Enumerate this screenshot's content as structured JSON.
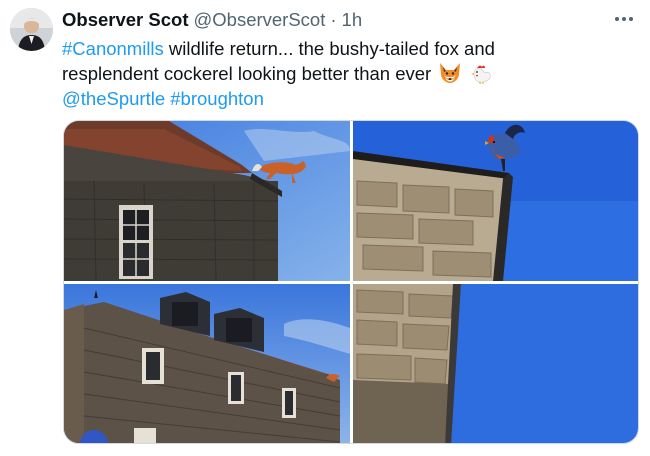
{
  "author": {
    "name": "Observer Scot",
    "handle": "@ObserverScot",
    "separator": "·",
    "time": "1h"
  },
  "tweet": {
    "line1": {
      "hashtag": "#Canonmills",
      "text": " wildlife return... the bushy-tailed fox and"
    },
    "line2": {
      "text": "resplendent cockerel looking better than ever"
    },
    "emojis": [
      "fox-emoji",
      "rooster-emoji"
    ],
    "mentions": {
      "mention": "@theSpurtle",
      "hashtag": "#broughton"
    }
  },
  "media": {
    "images": [
      "fox-on-roof-photo",
      "cockerel-weathervane-photo",
      "stone-house-photo",
      "wall-corner-photo"
    ]
  },
  "colors": {
    "link": "#1d9bf0",
    "text": "#0f1419",
    "secondary": "#536471",
    "border": "#cfd9de",
    "sky": "#2e6ee0"
  }
}
